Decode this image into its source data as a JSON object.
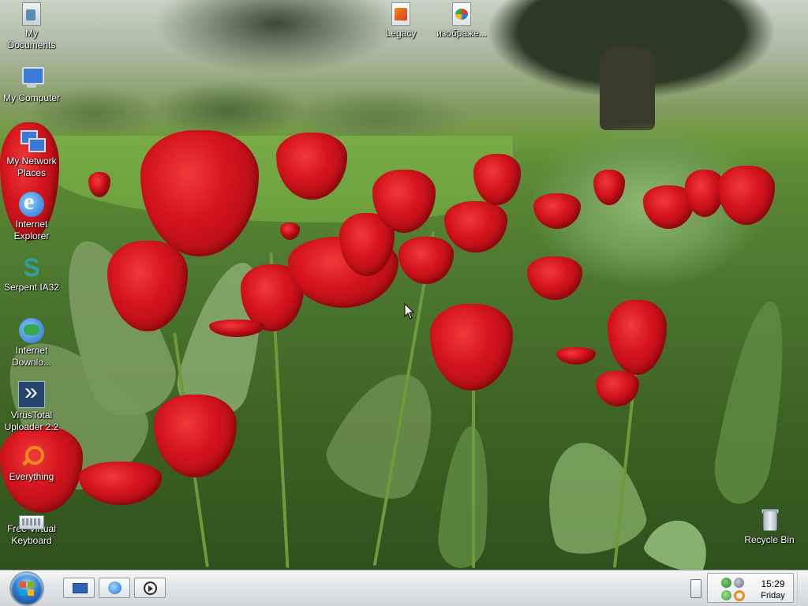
{
  "desktop": {
    "icons_left": [
      {
        "label": "My Documents",
        "icon": "my-documents-icon"
      },
      {
        "label": "My Computer",
        "icon": "my-computer-icon"
      },
      {
        "label": "My Network Places",
        "icon": "network-places-icon"
      },
      {
        "label": "Internet Explorer",
        "icon": "internet-explorer-icon"
      },
      {
        "label": "Serpent IA32",
        "icon": "serpent-icon"
      },
      {
        "label": "Internet Downlo...",
        "icon": "internet-download-manager-icon"
      },
      {
        "label": "VirusTotal Uploader 2.2",
        "icon": "virustotal-icon"
      },
      {
        "label": "Everything",
        "icon": "everything-search-icon"
      },
      {
        "label": "Free Virtual Keyboard",
        "icon": "keyboard-icon"
      }
    ],
    "icons_top": [
      {
        "label": "Legacy",
        "icon": "legacy-file-icon"
      },
      {
        "label": "изображе...",
        "icon": "image-file-icon"
      }
    ],
    "recycle_bin": {
      "label": "Recycle Bin",
      "icon": "recycle-bin-icon"
    }
  },
  "taskbar": {
    "start_icon": "windows-start-icon",
    "quick_launch": [
      {
        "name": "show-desktop",
        "icon": "desktop-icon"
      },
      {
        "name": "internet-explorer",
        "icon": "internet-explorer-icon"
      },
      {
        "name": "media-player",
        "icon": "media-player-icon"
      }
    ],
    "clock": {
      "time": "15:29",
      "day": "Friday"
    }
  },
  "colors": {
    "taskbar_bg": "#e3e6e8",
    "icon_label_text": "#ffffff",
    "start_orb": "#2f7dd0"
  }
}
